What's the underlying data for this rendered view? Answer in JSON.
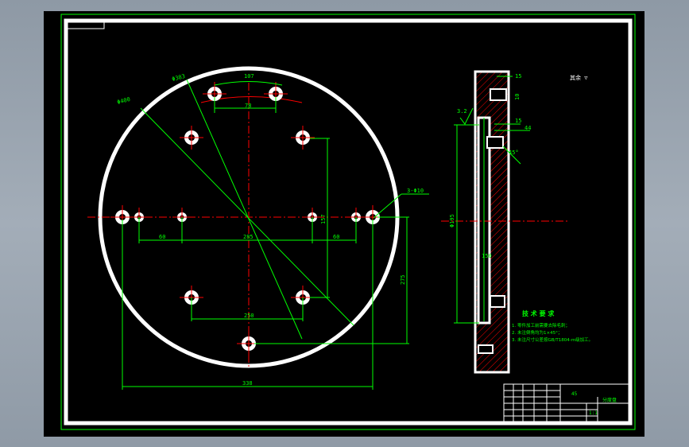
{
  "colors": {
    "background": "#000000",
    "outline": "#ffffff",
    "dimension": "#00ff00",
    "centerline": "#ff0000",
    "hatch": "#ff0000",
    "window_frame": "#8e99a5"
  },
  "plan_view": {
    "dimensions": {
      "outer_diameter": "Φ400",
      "inner_diameter": "Φ383",
      "top_arc": "107",
      "top_spacing": "78",
      "hole_callout": "3-Φ10",
      "mid_span": "285",
      "lower_span": "250",
      "vertical_1": "157",
      "vertical_2": "275",
      "bottom_span": "338",
      "left_offset": "60",
      "right_offset": "60"
    }
  },
  "section_view": {
    "dimensions": {
      "top_width": "15",
      "top_height": "10",
      "groove_width": "15",
      "groove_depth": "44",
      "chamfer": "45°",
      "side_overall": "Φ195",
      "inner_length": "150",
      "roughness_mark": "3.2"
    }
  },
  "roughness_note": "其余 ▽",
  "technical_requirements": {
    "title": "技 术 要 求",
    "items": [
      "1. 零件加工前需要去除毛刺；",
      "2. 未注倒角均为1×45°；",
      "3. 未注尺寸公差按GB/T1804-m级加工。"
    ]
  },
  "title_block": {
    "part_name": "分度盘",
    "material": "45",
    "scale": "1:1"
  }
}
